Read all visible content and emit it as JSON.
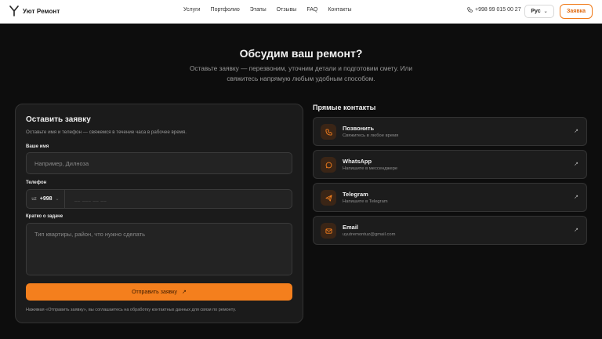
{
  "header": {
    "logo_text": "Уют Ремонт",
    "nav": [
      "Услуги",
      "Портфолио",
      "Этапы",
      "Отзывы",
      "FAQ",
      "Контакты"
    ],
    "phone": "+998 99 015 00 27",
    "lang": "Рус",
    "cta": "Заявка"
  },
  "hero": {
    "title": "Обсудим ваш ремонт?",
    "subtitle": "Оставьте заявку — перезвоним, уточним детали и подготовим смету. Или свяжитесь напрямую любым удобным способом."
  },
  "form": {
    "title": "Оставить заявку",
    "desc": "Оставьте имя и телефон — свяжемся в течение часа в рабочее время.",
    "name_label": "Ваше имя",
    "name_placeholder": "Например, Дилноза",
    "phone_label": "Телефон",
    "phone_flag": "uz",
    "phone_code": "+998",
    "phone_placeholder": "__ ___ __ __",
    "task_label": "Кратко о задаче",
    "task_placeholder": "Тип квартиры, район, что нужно сделать",
    "submit": "Отправить заявку",
    "consent": "Нажимая «Отправить заявку», вы соглашаетесь на обработку контактных данных для связи по ремонту."
  },
  "contacts": {
    "title": "Прямые контакты",
    "items": [
      {
        "name": "Позвонить",
        "sub": "Свяжитесь в любое время",
        "icon": "phone-icon"
      },
      {
        "name": "WhatsApp",
        "sub": "Напишите в мессенджере",
        "icon": "whatsapp-icon"
      },
      {
        "name": "Telegram",
        "sub": "Напишите в Telegram",
        "icon": "telegram-icon"
      },
      {
        "name": "Email",
        "sub": "uyutremontuz@gmail.com",
        "icon": "mail-icon"
      }
    ]
  },
  "colors": {
    "accent": "#f47f1d",
    "background": "#0d0d0d",
    "card": "#1b1b1b"
  }
}
